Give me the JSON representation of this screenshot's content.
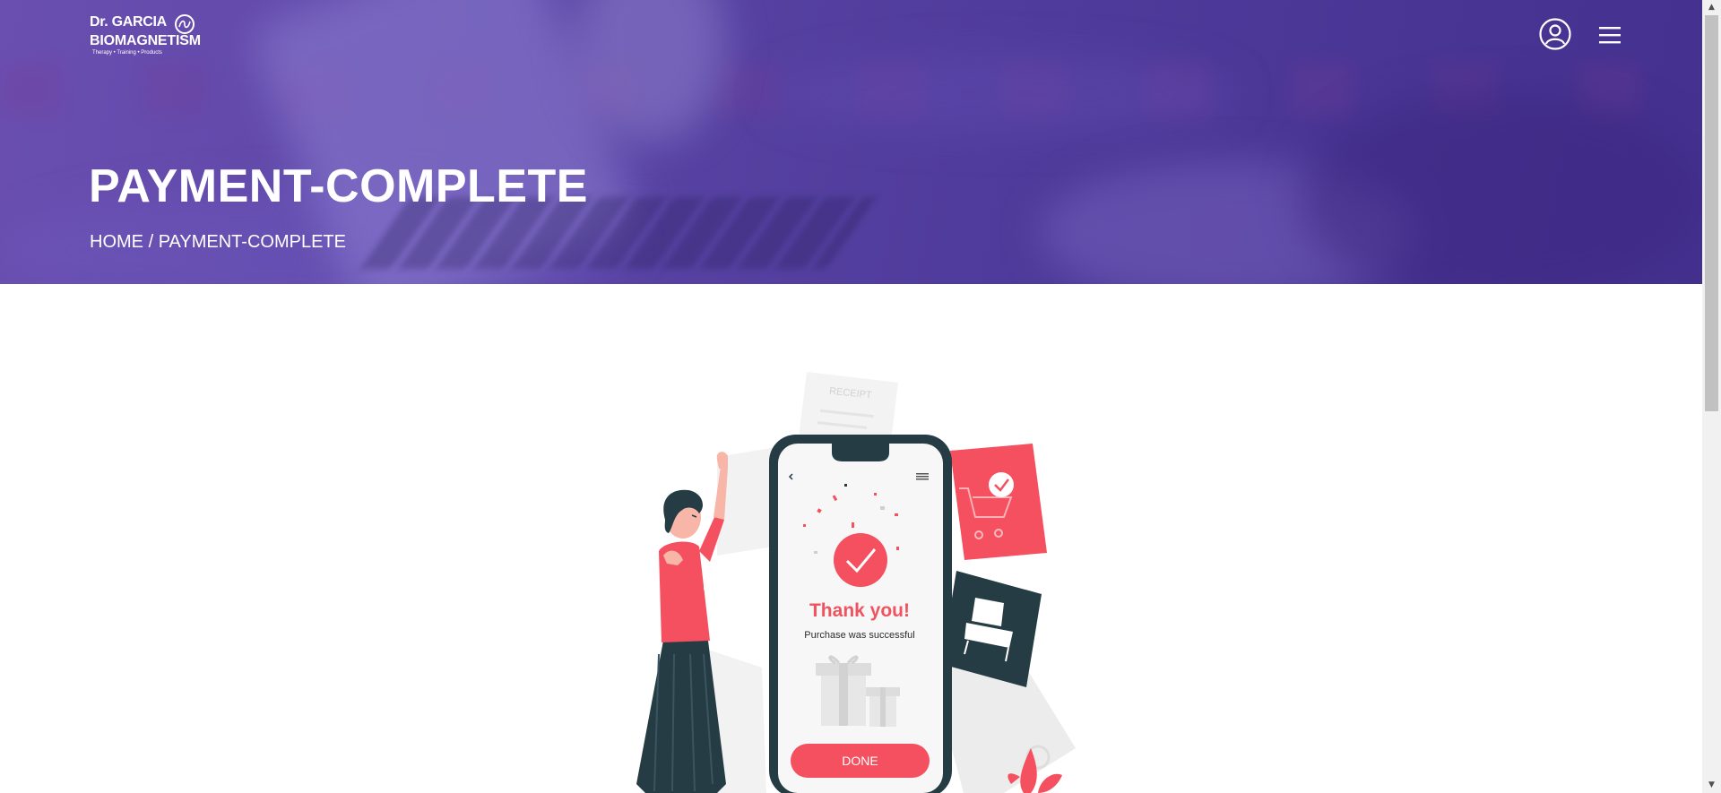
{
  "header": {
    "logo": {
      "line1": "Dr. GARCIA",
      "line2": "BIOMAGNETISM",
      "tagline": "Therapy • Training • Products"
    },
    "icons": [
      "user-icon",
      "menu-icon"
    ]
  },
  "hero": {
    "title": "PAYMENT-COMPLETE",
    "breadcrumb": {
      "home": "HOME",
      "separator": "/",
      "current": "PAYMENT-COMPLETE"
    }
  },
  "illustration": {
    "receipt_label": "RECEIPT",
    "heading": "Thank you!",
    "message": "Purchase was successful",
    "button": "DONE"
  },
  "colors": {
    "hero_purple": "#5b45a6",
    "accent_red": "#f4505f",
    "dark_teal": "#263c44"
  }
}
